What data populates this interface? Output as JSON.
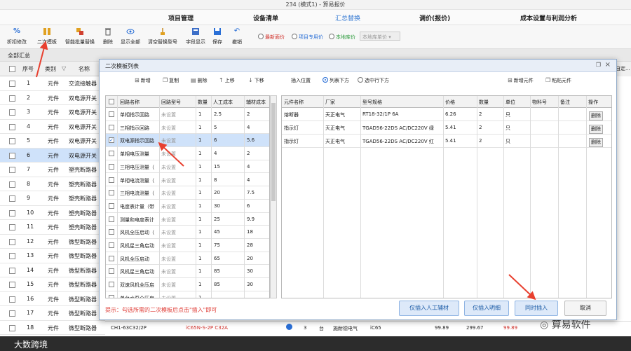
{
  "window": {
    "title": "234 (模式1) - 算易报价"
  },
  "menu": [
    "项目管理",
    "设备清单",
    "汇总替换",
    "调价(报价)",
    "成本设置与利润分析"
  ],
  "toolbar": {
    "buttons": [
      {
        "label": "折扣修改",
        "icon": "percent-icon"
      },
      {
        "label": "二次模板",
        "icon": "template-icon"
      },
      {
        "label": "智能批量替换",
        "icon": "batch-replace-icon"
      },
      {
        "label": "删除",
        "icon": "trash-icon"
      },
      {
        "label": "显示全部",
        "icon": "eye-icon"
      },
      {
        "label": "清空替换型号",
        "icon": "broom-icon"
      },
      {
        "label": "字段显示",
        "icon": "field-icon"
      },
      {
        "label": "保存",
        "icon": "save-icon"
      },
      {
        "label": "撤销",
        "icon": "undo-icon"
      }
    ],
    "radios": [
      "最新面价",
      "项目专用价",
      "本地库价"
    ],
    "combo_placeholder": "本地库单价"
  },
  "summary_label": "全部汇总",
  "background_table": {
    "headers": [
      "序号",
      "类别",
      "名称"
    ],
    "right_header": "自定...",
    "rows": [
      {
        "no": "1",
        "cat": "元件",
        "name": "交流接触器"
      },
      {
        "no": "2",
        "cat": "元件",
        "name": "双电源开关"
      },
      {
        "no": "3",
        "cat": "元件",
        "name": "双电源开关"
      },
      {
        "no": "4",
        "cat": "元件",
        "name": "双电源开关"
      },
      {
        "no": "5",
        "cat": "元件",
        "name": "双电源开关"
      },
      {
        "no": "6",
        "cat": "元件",
        "name": "双电源开关"
      },
      {
        "no": "7",
        "cat": "元件",
        "name": "塑壳断路器"
      },
      {
        "no": "8",
        "cat": "元件",
        "name": "塑壳断路器"
      },
      {
        "no": "9",
        "cat": "元件",
        "name": "塑壳断路器"
      },
      {
        "no": "10",
        "cat": "元件",
        "name": "塑壳断路器"
      },
      {
        "no": "11",
        "cat": "元件",
        "name": "塑壳断路器"
      },
      {
        "no": "12",
        "cat": "元件",
        "name": "微型断路器"
      },
      {
        "no": "13",
        "cat": "元件",
        "name": "微型断路器"
      },
      {
        "no": "14",
        "cat": "元件",
        "name": "微型断路器"
      },
      {
        "no": "15",
        "cat": "元件",
        "name": "微型断路器"
      },
      {
        "no": "16",
        "cat": "元件",
        "name": "微型断路器"
      },
      {
        "no": "17",
        "cat": "元件",
        "name": "微型断路器"
      },
      {
        "no": "18",
        "cat": "元件",
        "name": "微型断路器"
      }
    ],
    "selected_index": 5,
    "bottom_row": [
      "CH1-63C32/2P",
      "iC65N-S-2P C32A",
      "3",
      "台",
      "施耐德电气",
      "iC65",
      "99.89",
      "299.67",
      "99.89"
    ]
  },
  "dialog": {
    "title": "二次模板列表",
    "left_toolbar": [
      {
        "glyph": "⊞",
        "label": "新增"
      },
      {
        "glyph": "❐",
        "label": "复制"
      },
      {
        "glyph": "▤",
        "label": "删除"
      },
      {
        "glyph": "↑",
        "label": "上移"
      },
      {
        "glyph": "↓",
        "label": "下移"
      }
    ],
    "insert_position_label": "插入位置",
    "insert_options": [
      "列表下方",
      "选中行下方"
    ],
    "right_toolbar": [
      {
        "glyph": "⊞",
        "label": "新增元件"
      },
      {
        "glyph": "❐",
        "label": "粘贴元件"
      }
    ],
    "left_headers": [
      "回路名称",
      "回路型号",
      "数量",
      "人工成本",
      "辅材成本"
    ],
    "left_rows": [
      {
        "name": "单相指示回路",
        "model": "未设置",
        "qty": "1",
        "labor": "2.5",
        "aux": "2",
        "checked": false
      },
      {
        "name": "三相指示回路",
        "model": "未设置",
        "qty": "1",
        "labor": "5",
        "aux": "4",
        "checked": false
      },
      {
        "name": "双电源指示回路",
        "model": "未设置",
        "qty": "1",
        "labor": "6",
        "aux": "5.6",
        "checked": true
      },
      {
        "name": "单相电压测量",
        "model": "未设置",
        "qty": "1",
        "labor": "4",
        "aux": "2",
        "checked": false
      },
      {
        "name": "三相电压测量（",
        "model": "未设置",
        "qty": "1",
        "labor": "15",
        "aux": "4",
        "checked": false
      },
      {
        "name": "单相电流测量（",
        "model": "未设置",
        "qty": "1",
        "labor": "8",
        "aux": "4",
        "checked": false
      },
      {
        "name": "三相电流测量（",
        "model": "未设置",
        "qty": "1",
        "labor": "20",
        "aux": "7.5",
        "checked": false
      },
      {
        "name": "电度表计量（带",
        "model": "未设置",
        "qty": "1",
        "labor": "30",
        "aux": "6",
        "checked": false
      },
      {
        "name": "测量和电度表计",
        "model": "未设置",
        "qty": "1",
        "labor": "25",
        "aux": "9.9",
        "checked": false
      },
      {
        "name": "风机全压启动（",
        "model": "未设置",
        "qty": "1",
        "labor": "45",
        "aux": "18",
        "checked": false
      },
      {
        "name": "风机星三角启动",
        "model": "未设置",
        "qty": "1",
        "labor": "75",
        "aux": "28",
        "checked": false
      },
      {
        "name": "风机全压启动",
        "model": "未设置",
        "qty": "1",
        "labor": "65",
        "aux": "20",
        "checked": false
      },
      {
        "name": "风机星三角启动",
        "model": "未设置",
        "qty": "1",
        "labor": "85",
        "aux": "30",
        "checked": false
      },
      {
        "name": "双速风机全压启",
        "model": "未设置",
        "qty": "1",
        "labor": "85",
        "aux": "30",
        "checked": false
      },
      {
        "name": "单台水泵全压启",
        "model": "未设置",
        "qty": "1",
        "labor": "",
        "aux": "",
        "checked": false
      }
    ],
    "right_headers": [
      "元件名称",
      "厂家",
      "型号规格",
      "价格",
      "数量",
      "单位",
      "物料号",
      "备注",
      "操作"
    ],
    "right_rows": [
      {
        "name": "熔断器",
        "maker": "天正电气",
        "model": "RT18-32/1P 6A",
        "price": "6.26",
        "qty": "2",
        "unit": "只",
        "action": "删除"
      },
      {
        "name": "指示灯",
        "maker": "天正电气",
        "model": "TGAD56-22DS AC/DC220V 绿",
        "price": "5.41",
        "qty": "2",
        "unit": "只",
        "action": "删除"
      },
      {
        "name": "指示灯",
        "maker": "天正电气",
        "model": "TGAD56-22DS AC/DC220V 红",
        "price": "5.41",
        "qty": "2",
        "unit": "只",
        "action": "删除"
      }
    ],
    "hint": "提示：勾选所需的二次模板后点击\"插入\"即可",
    "buttons": [
      "仅插入人工辅材",
      "仅插入明细",
      "同时插入",
      "取消"
    ]
  },
  "watermark": "算易软件",
  "status_text": "大数跨境",
  "colors": {
    "accent": "#3d7fd4",
    "selected_row": "#cfe2fa",
    "hint": "#e0403a",
    "arrow": "#e8402f"
  }
}
